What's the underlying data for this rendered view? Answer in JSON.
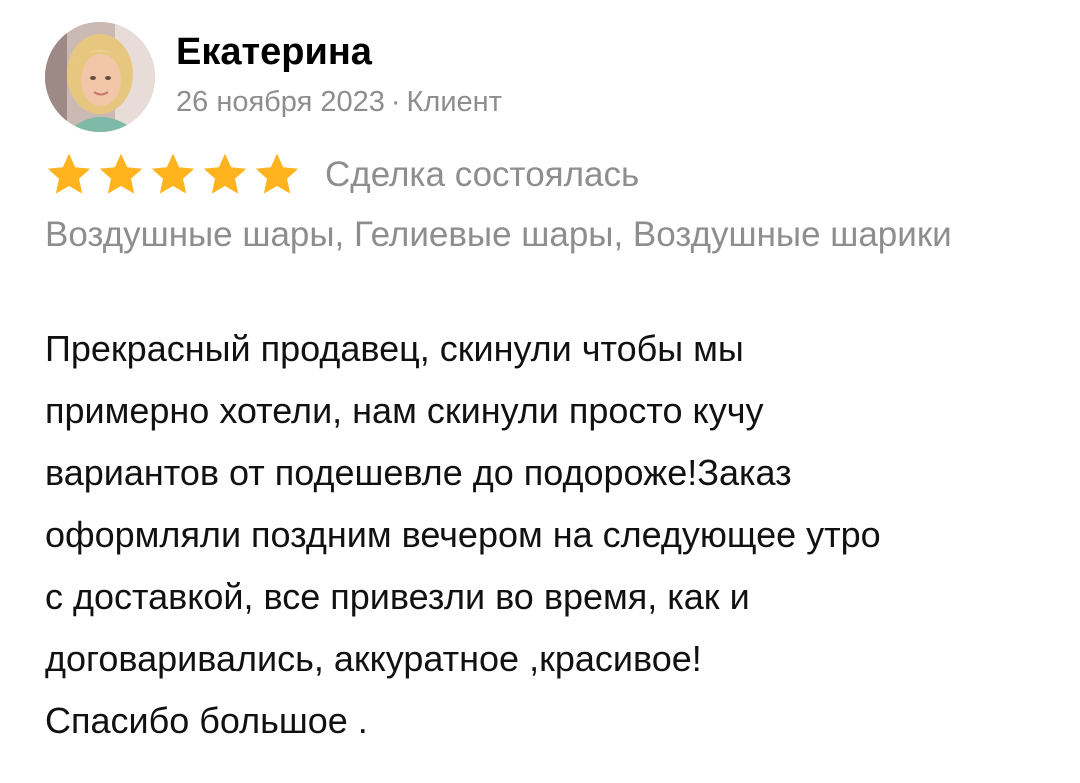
{
  "author": {
    "name": "Екатерина",
    "date": "26 ноября 2023",
    "separator": "·",
    "role": "Клиент"
  },
  "rating": {
    "stars": 5,
    "max_stars": 5,
    "star_color": "#FFB31F",
    "deal_status": "Сделка состоялась"
  },
  "categories": "Воздушные шары, Гелиевые шары, Воздушные шарики",
  "review_text": "Прекрасный продавец, скинули чтобы мы\nпримерно хотели, нам скинули просто кучу\nвариантов от подешевле до подороже!Заказ\nоформляли поздним вечером на следующее утро\nс доставкой, все привезли во время, как и\nдоговаривались, аккуратное ,красивое!\nСпасибо большое ."
}
